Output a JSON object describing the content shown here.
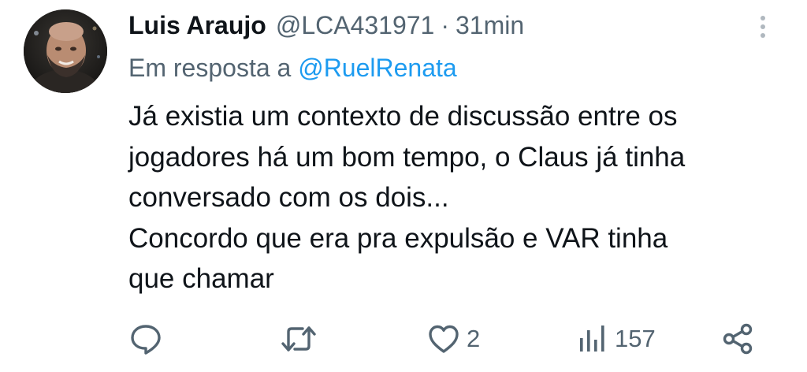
{
  "tweet": {
    "author_name": "Luis Araujo",
    "handle": "@LCA431971",
    "separator": "·",
    "time": "31min",
    "reply_prefix": "Em resposta a",
    "reply_mention": "@RuelRenata",
    "paragraphs": [
      "Já existia um contexto de discussão entre os\njogadores há um bom tempo, o Claus já tinha\nconversado com os dois...",
      "Concordo que era pra expulsão e VAR tinha\nque chamar"
    ]
  },
  "actions": {
    "reply_icon": "reply-icon",
    "retweet_icon": "retweet-icon",
    "like_icon": "heart-icon",
    "like_count": "2",
    "views_icon": "views-icon",
    "views_count": "157",
    "share_icon": "share-icon"
  },
  "colors": {
    "text_primary": "#0f1419",
    "text_secondary": "#536471",
    "link": "#1d9bf0"
  }
}
